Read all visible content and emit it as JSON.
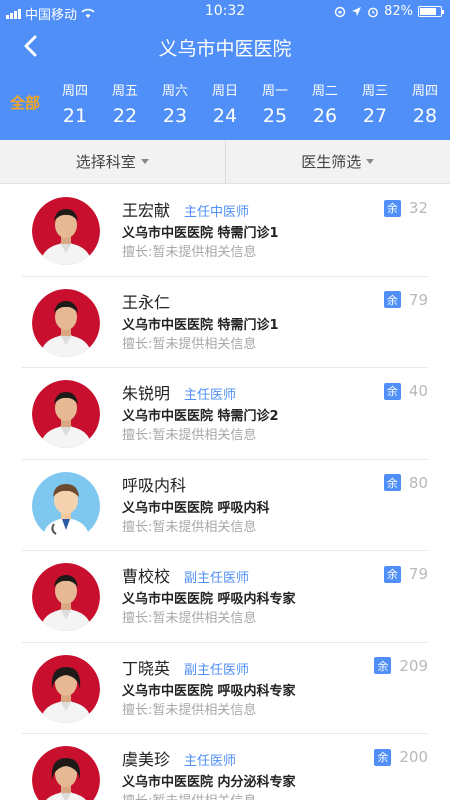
{
  "status_bar": {
    "carrier": "中国移动",
    "time": "10:32",
    "battery": "82%",
    "battery_level": 0.82
  },
  "nav": {
    "title": "义乌市中医医院"
  },
  "all_label": "全部",
  "days": [
    {
      "weekday": "周四",
      "date": "21"
    },
    {
      "weekday": "周五",
      "date": "22"
    },
    {
      "weekday": "周六",
      "date": "23"
    },
    {
      "weekday": "周日",
      "date": "24"
    },
    {
      "weekday": "周一",
      "date": "25"
    },
    {
      "weekday": "周二",
      "date": "26"
    },
    {
      "weekday": "周三",
      "date": "27"
    },
    {
      "weekday": "周四",
      "date": "28"
    }
  ],
  "filters": {
    "department": "选择科室",
    "doctor": "医生筛选"
  },
  "remain_badge": "余",
  "doctors": [
    {
      "name": "王宏献",
      "title": "主任中医师",
      "hospital": "义乌市中医医院 特需门诊1",
      "specialty": "擅长:暂未提供相关信息",
      "remaining": "32",
      "photo": "photo"
    },
    {
      "name": "王永仁",
      "title": "",
      "hospital": "义乌市中医医院 特需门诊1",
      "specialty": "擅长:暂未提供相关信息",
      "remaining": "79",
      "photo": "photo"
    },
    {
      "name": "朱锐明",
      "title": "主任医师",
      "hospital": "义乌市中医医院 特需门诊2",
      "specialty": "擅长:暂未提供相关信息",
      "remaining": "40",
      "photo": "photo"
    },
    {
      "name": "呼吸内科",
      "title": "",
      "hospital": "义乌市中医医院 呼吸内科",
      "specialty": "擅长:暂未提供相关信息",
      "remaining": "80",
      "photo": "placeholder"
    },
    {
      "name": "曹校校",
      "title": "副主任医师",
      "hospital": "义乌市中医医院 呼吸内科专家",
      "specialty": "擅长:暂未提供相关信息",
      "remaining": "79",
      "photo": "photo"
    },
    {
      "name": "丁晓英",
      "title": "副主任医师",
      "hospital": "义乌市中医医院 呼吸内科专家",
      "specialty": "擅长:暂未提供相关信息",
      "remaining": "209",
      "photo": "photo-female"
    },
    {
      "name": "虞美珍",
      "title": "主任医师",
      "hospital": "义乌市中医医院 内分泌科专家",
      "specialty": "擅长:暂未提供相关信息",
      "remaining": "200",
      "photo": "photo-female"
    }
  ],
  "colors": {
    "accent": "#4f8ff7",
    "all_highlight": "#f5a623",
    "avatar_bg": "#c8102e"
  }
}
